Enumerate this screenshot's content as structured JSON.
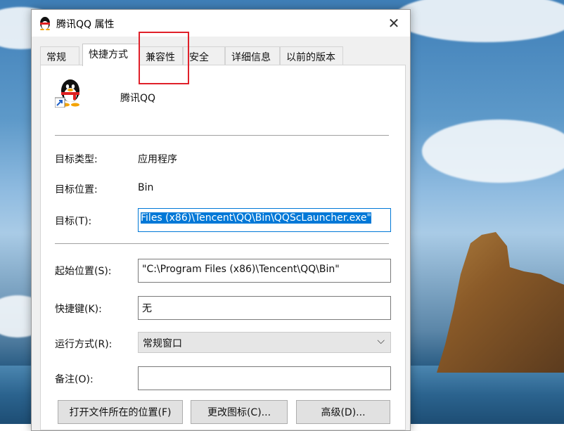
{
  "window": {
    "title": "腾讯QQ 属性",
    "close_glyph": "✕"
  },
  "tabs": [
    {
      "label": "常规",
      "active": false
    },
    {
      "label": "快捷方式",
      "active": true
    },
    {
      "label": "兼容性",
      "active": false
    },
    {
      "label": "安全",
      "active": false
    },
    {
      "label": "详细信息",
      "active": false
    },
    {
      "label": "以前的版本",
      "active": false
    }
  ],
  "shortcut": {
    "app_name": "腾讯QQ",
    "app_icon": "qq-penguin-icon",
    "target_type_label": "目标类型:",
    "target_type_value": "应用程序",
    "target_location_label": "目标位置:",
    "target_location_value": "Bin",
    "target_label": "目标(T):",
    "target_value": " Files (x86)\\Tencent\\QQ\\Bin\\QQScLauncher.exe\"",
    "start_in_label": "起始位置(S):",
    "start_in_value": "\"C:\\Program Files (x86)\\Tencent\\QQ\\Bin\"",
    "hotkey_label": "快捷键(K):",
    "hotkey_value": "无",
    "run_label": "运行方式(R):",
    "run_value": "常规窗口",
    "comment_label": "备注(O):",
    "comment_value": ""
  },
  "buttons": {
    "open_location": "打开文件所在的位置(F)",
    "change_icon": "更改图标(C)...",
    "advanced": "高级(D)..."
  },
  "colors": {
    "highlight_box": "#e0202a",
    "selection": "#0078d7"
  }
}
